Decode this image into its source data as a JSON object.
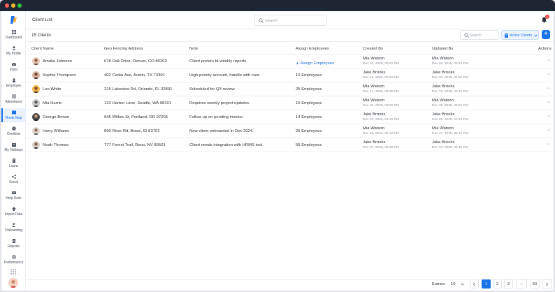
{
  "header": {
    "title": "Client List",
    "search_placeholder": "Search",
    "notification_count": "1"
  },
  "sidebar": {
    "items": [
      {
        "label": "Dashboard",
        "icon": "dashboard-icon"
      },
      {
        "label": "My Profile",
        "icon": "user-icon"
      },
      {
        "label": "Inbox",
        "icon": "mail-icon"
      },
      {
        "label": "Employee",
        "icon": "person-icon"
      },
      {
        "label": "Attendance",
        "icon": "list-icon"
      },
      {
        "label": "Route Map",
        "icon": "map-icon",
        "active": true
      },
      {
        "label": "Overtime",
        "icon": "clock-icon"
      },
      {
        "label": "My Holidays",
        "icon": "calendar-icon"
      },
      {
        "label": "Loans",
        "icon": "document-icon"
      },
      {
        "label": "Social",
        "icon": "share-icon"
      },
      {
        "label": "Help Desk",
        "icon": "help-icon"
      },
      {
        "label": "Import Data",
        "icon": "upload-icon"
      },
      {
        "label": "Onboarding",
        "icon": "onboarding-icon"
      },
      {
        "label": "Reports",
        "icon": "report-icon"
      },
      {
        "label": "Performance",
        "icon": "performance-icon"
      }
    ]
  },
  "toolbar": {
    "count_label": "15 Clients",
    "search_placeholder": "Search",
    "status_filter": "Active Clients",
    "add_label": "+"
  },
  "table": {
    "columns": [
      "Client Name",
      "Geo Fencing Address",
      "Note",
      "Assign Employees",
      "Created By",
      "Updated By",
      "Actions"
    ],
    "rows": [
      {
        "name": "Amalia Johnson",
        "address": "678 Oak Drive, Denver, CO 80203",
        "note": "Client prefers bi-weekly reports.",
        "assign": "Assign Employees",
        "assign_is_link": true,
        "created_by": "Mia Watson",
        "created_at": "Dec 20, 2025, 05:42 PM",
        "updated_by": "Mia Watson",
        "updated_at": "Dec 20, 2025, 05:42 PM",
        "actions": "···"
      },
      {
        "name": "Sophia Thompson",
        "address": "402 Cedar Ave, Austin, TX 73301",
        "note": "High-priority account, handle with care.",
        "assign": "10 Employees",
        "assign_is_link": false,
        "created_by": "Jake Brooks",
        "created_at": "Dec 19, 2025, 02:52 PM",
        "updated_by": "Jake Brooks",
        "updated_at": "Dec 20, 2025, 02:52 PM",
        "actions": "···"
      },
      {
        "name": "Leo White",
        "address": "215 Lakeview Rd, Orlando, FL 32801",
        "note": "Scheduled for Q3 review.",
        "assign": "25 Employees",
        "assign_is_link": false,
        "created_by": "Mia Watson",
        "created_at": "Dec 12, 2025, 03:32 PM",
        "updated_by": "Jake Brooks",
        "updated_at": "Dec 22, 2025, 03:32 PM",
        "actions": "···"
      },
      {
        "name": "Mia Harris",
        "address": "123 Harbor Lane, Seattle, WA 98101",
        "note": "Requires weekly project updates.",
        "assign": "15 Employees",
        "assign_is_link": false,
        "created_by": "Mia Watson",
        "created_at": "Dec 20, 2025, 03:22 PM",
        "updated_by": "Mia Watson",
        "updated_at": "Dec 25, 2025, 03:22 PM",
        "actions": "···"
      },
      {
        "name": "George Brown",
        "address": "945 Willow St, Portland, OR 97205",
        "note": "Follow up on pending invoice.",
        "assign": "14 Employees",
        "assign_is_link": false,
        "created_by": "Jake Brooks",
        "created_at": "Dec 20, 2025, 04:42 PM",
        "updated_by": "Jake Brooks",
        "updated_at": "Dec 25, 2025, 04:42 PM",
        "actions": "···"
      },
      {
        "name": "Harry Williams",
        "address": "890 River Rd, Boise, ID 83702",
        "note": "New client onboarded in Dec 2024.",
        "assign": "25 Employees",
        "assign_is_link": false,
        "created_by": "Mia Watson",
        "created_at": "Dec 20, 2025, 05:12 PM",
        "updated_by": "Mia Watson",
        "updated_at": "Dec 27, 2025, 05:12 PM",
        "actions": "···"
      },
      {
        "name": "Noah Thomas",
        "address": "777 Forest Trail, Reno, NV 89501",
        "note": "Client needs integration with HRMS tool.",
        "assign": "55 Employees",
        "assign_is_link": false,
        "created_by": "Jake Brooks",
        "created_at": "Dec 20, 2025, 06:40 PM",
        "updated_by": "Jake Brooks",
        "updated_at": "Dec 20, 2025, 06:40 PM",
        "actions": "···"
      }
    ]
  },
  "footer": {
    "entries_label": "Entries",
    "entries_value": "10",
    "pages": [
      "1",
      "2",
      "3",
      "···",
      "50"
    ],
    "current_page": "1"
  },
  "colors": {
    "accent": "#1a73e8",
    "active_bg": "#e9f1fd",
    "badge": "#e8453c",
    "titlebar": "#1e2533"
  }
}
